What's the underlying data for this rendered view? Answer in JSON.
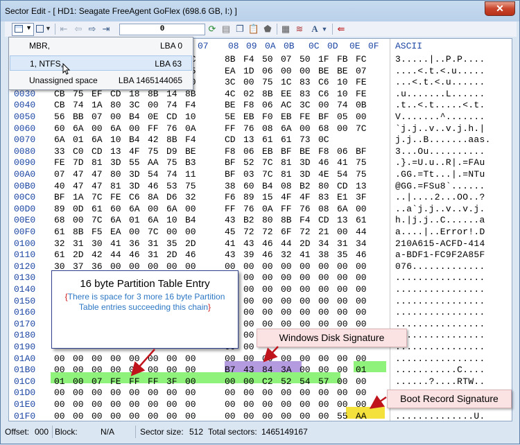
{
  "window": {
    "title": "Sector Edit - [ HD1: Seagate FreeAgent GoFlex (698.6 GB, I:) ]",
    "close_glyph": "✕"
  },
  "toolbar": {
    "lba_value": "0",
    "icons": [
      "partition-dropdown-icon",
      "view-dropdown-icon",
      "first-icon",
      "back-icon",
      "forward-icon",
      "last-icon",
      "refresh-icon",
      "save-icon",
      "copy-icon",
      "paste-icon",
      "fill-icon",
      "calculator-icon",
      "codepage-icon",
      "font-icon",
      "exit-icon"
    ]
  },
  "menu": {
    "items": [
      {
        "label": "MBR,",
        "lba": "LBA 0"
      },
      {
        "label": "1, NTFS,",
        "lba": "LBA 63"
      },
      {
        "label": "Unassigned space",
        "lba": "LBA 1465144065"
      }
    ]
  },
  "hex_header": {
    "cols": [
      "07",
      "08",
      "09",
      "0A",
      "0B",
      "0C",
      "0D",
      "0E",
      "0F"
    ],
    "ascii": "ASCII"
  },
  "rows": [
    {
      "off": "0000",
      "bytes": [
        "",
        "",
        "",
        "",
        "",
        "",
        "",
        "7C",
        "8B",
        "F4",
        "50",
        "07",
        "50",
        "1F",
        "FB",
        "FC"
      ],
      "ascii": "3.....|..P.P...."
    },
    {
      "off": "0010",
      "bytes": [
        "",
        "",
        "",
        "",
        "",
        "",
        "",
        "A5",
        "EA",
        "1D",
        "06",
        "00",
        "00",
        "BE",
        "BE",
        "07"
      ],
      "ascii": "....<.t.<.u....."
    },
    {
      "off": "0020",
      "bytes": [
        "",
        "",
        "",
        "",
        "",
        "",
        "",
        "80",
        "3C",
        "00",
        "75",
        "1C",
        "83",
        "C6",
        "10",
        "FE"
      ],
      "ascii": "...<.t.<.u......"
    },
    {
      "off": "0030",
      "bytes": [
        "CB",
        "75",
        "EF",
        "CD",
        "18",
        "8B",
        "14",
        "8B",
        "4C",
        "02",
        "8B",
        "EE",
        "83",
        "C6",
        "10",
        "FE"
      ],
      "ascii": ".u.......L......"
    },
    {
      "off": "0040",
      "bytes": [
        "CB",
        "74",
        "1A",
        "80",
        "3C",
        "00",
        "74",
        "F4",
        "BE",
        "F8",
        "06",
        "AC",
        "3C",
        "00",
        "74",
        "0B"
      ],
      "ascii": ".t..<.t.....<.t."
    },
    {
      "off": "0050",
      "bytes": [
        "56",
        "BB",
        "07",
        "00",
        "B4",
        "0E",
        "CD",
        "10",
        "5E",
        "EB",
        "F0",
        "EB",
        "FE",
        "BF",
        "05",
        "00"
      ],
      "ascii": "V.......^......."
    },
    {
      "off": "0060",
      "bytes": [
        "60",
        "6A",
        "00",
        "6A",
        "00",
        "FF",
        "76",
        "0A",
        "FF",
        "76",
        "08",
        "6A",
        "00",
        "68",
        "00",
        "7C"
      ],
      "ascii": "`j.j..v..v.j.h.|"
    },
    {
      "off": "0070",
      "bytes": [
        "6A",
        "01",
        "6A",
        "10",
        "B4",
        "42",
        "8B",
        "F4",
        "CD",
        "13",
        "61",
        "61",
        "73",
        "0C",
        "",
        ""
      ],
      "ascii": "j.j..B.......aas."
    },
    {
      "off": "0080",
      "bytes": [
        "33",
        "C0",
        "CD",
        "13",
        "4F",
        "75",
        "D9",
        "BE",
        "F8",
        "06",
        "EB",
        "BF",
        "BE",
        "F8",
        "06",
        "BF"
      ],
      "ascii": "3...Ou.........."
    },
    {
      "off": "0090",
      "bytes": [
        "FE",
        "7D",
        "81",
        "3D",
        "55",
        "AA",
        "75",
        "B3",
        "BF",
        "52",
        "7C",
        "81",
        "3D",
        "46",
        "41",
        "75"
      ],
      "ascii": ".}.=U.u..R|.=FAu"
    },
    {
      "off": "00A0",
      "bytes": [
        "07",
        "47",
        "47",
        "80",
        "3D",
        "54",
        "74",
        "11",
        "BF",
        "03",
        "7C",
        "81",
        "3D",
        "4E",
        "54",
        "75"
      ],
      "ascii": ".GG.=Tt...|.=NTu"
    },
    {
      "off": "00B0",
      "bytes": [
        "40",
        "47",
        "47",
        "81",
        "3D",
        "46",
        "53",
        "75",
        "38",
        "60",
        "B4",
        "08",
        "B2",
        "80",
        "CD",
        "13"
      ],
      "ascii": "@GG.=FSu8`......"
    },
    {
      "off": "00C0",
      "bytes": [
        "BF",
        "1A",
        "7C",
        "FE",
        "C6",
        "8A",
        "D6",
        "32",
        "F6",
        "89",
        "15",
        "4F",
        "4F",
        "83",
        "E1",
        "3F"
      ],
      "ascii": "..|....2...OO..?"
    },
    {
      "off": "00D0",
      "bytes": [
        "89",
        "0D",
        "61",
        "60",
        "6A",
        "00",
        "6A",
        "00",
        "FF",
        "76",
        "0A",
        "FF",
        "76",
        "08",
        "6A",
        "00"
      ],
      "ascii": "..a`j.j..v..v.j."
    },
    {
      "off": "00E0",
      "bytes": [
        "68",
        "00",
        "7C",
        "6A",
        "01",
        "6A",
        "10",
        "B4",
        "43",
        "B2",
        "80",
        "8B",
        "F4",
        "CD",
        "13",
        "61"
      ],
      "ascii": "h.|j.j..C......a"
    },
    {
      "off": "00F0",
      "bytes": [
        "61",
        "8B",
        "F5",
        "EA",
        "00",
        "7C",
        "00",
        "00",
        "45",
        "72",
        "72",
        "6F",
        "72",
        "21",
        "00",
        "44"
      ],
      "ascii": "a....|..Error!.D"
    },
    {
      "off": "0100",
      "bytes": [
        "32",
        "31",
        "30",
        "41",
        "36",
        "31",
        "35",
        "2D",
        "41",
        "43",
        "46",
        "44",
        "2D",
        "34",
        "31",
        "34"
      ],
      "ascii": "210A615-ACFD-414"
    },
    {
      "off": "0110",
      "bytes": [
        "61",
        "2D",
        "42",
        "44",
        "46",
        "31",
        "2D",
        "46",
        "43",
        "39",
        "46",
        "32",
        "41",
        "38",
        "35",
        "46"
      ],
      "ascii": "a-BDF1-FC9F2A85F"
    },
    {
      "off": "0120",
      "bytes": [
        "30",
        "37",
        "36",
        "00",
        "00",
        "00",
        "00",
        "00",
        "00",
        "00",
        "00",
        "00",
        "00",
        "00",
        "00",
        "00"
      ],
      "ascii": "076............."
    },
    {
      "off": "0130",
      "bytes": [
        "",
        "",
        "",
        "",
        "",
        "",
        "",
        "",
        "00",
        "00",
        "00",
        "00",
        "00",
        "00",
        "00",
        "00"
      ],
      "ascii": "................"
    },
    {
      "off": "0140",
      "bytes": [
        "",
        "",
        "",
        "",
        "",
        "",
        "",
        "",
        "00",
        "00",
        "00",
        "00",
        "00",
        "00",
        "00",
        "00"
      ],
      "ascii": "................"
    },
    {
      "off": "0150",
      "bytes": [
        "",
        "",
        "",
        "",
        "",
        "",
        "",
        "",
        "00",
        "00",
        "00",
        "00",
        "00",
        "00",
        "00",
        "00"
      ],
      "ascii": "................"
    },
    {
      "off": "0160",
      "bytes": [
        "",
        "",
        "",
        "",
        "",
        "",
        "",
        "",
        "00",
        "00",
        "00",
        "00",
        "00",
        "00",
        "00",
        "00"
      ],
      "ascii": "................"
    },
    {
      "off": "0170",
      "bytes": [
        "",
        "",
        "",
        "",
        "",
        "",
        "",
        "",
        "00",
        "00",
        "00",
        "00",
        "00",
        "00",
        "00",
        "00"
      ],
      "ascii": "................"
    },
    {
      "off": "0180",
      "bytes": [
        "",
        "",
        "",
        "",
        "",
        "",
        "",
        "",
        "00",
        "00",
        "",
        "",
        "",
        "",
        "",
        ""
      ],
      "ascii": "................"
    },
    {
      "off": "0190",
      "bytes": [
        "",
        "",
        "",
        "",
        "",
        "",
        "",
        "",
        "00",
        "00",
        "",
        "",
        "",
        "",
        "",
        ""
      ],
      "ascii": "................"
    },
    {
      "off": "01A0",
      "bytes": [
        "00",
        "00",
        "00",
        "00",
        "00",
        "00",
        "00",
        "00",
        "00",
        "00",
        "00",
        "00",
        "00",
        "00",
        "00",
        "00"
      ],
      "ascii": "................"
    },
    {
      "off": "01B0",
      "bytes": [
        "00",
        "00",
        "00",
        "00",
        "00",
        "00",
        "00",
        "00",
        "B7",
        "43",
        "84",
        "3A",
        "00",
        "00",
        "00",
        "01"
      ],
      "ascii": "...........C...."
    },
    {
      "off": "01C0",
      "bytes": [
        "01",
        "00",
        "07",
        "FE",
        "FF",
        "FF",
        "3F",
        "00",
        "00",
        "00",
        "C2",
        "52",
        "54",
        "57",
        "00",
        "00"
      ],
      "ascii": "......?....RTW.."
    },
    {
      "off": "01D0",
      "bytes": [
        "00",
        "00",
        "00",
        "00",
        "00",
        "00",
        "00",
        "00",
        "00",
        "00",
        "00",
        "00",
        "00",
        "00",
        "00",
        "00"
      ],
      "ascii": "................"
    },
    {
      "off": "01E0",
      "bytes": [
        "00",
        "00",
        "00",
        "00",
        "00",
        "00",
        "00",
        "00",
        "00",
        "00",
        "00",
        "00",
        "00",
        "00",
        "00",
        "00"
      ],
      "ascii": "................"
    },
    {
      "off": "01F0",
      "bytes": [
        "00",
        "00",
        "00",
        "00",
        "00",
        "00",
        "00",
        "00",
        "00",
        "00",
        "00",
        "00",
        "00",
        "00",
        "55",
        "AA"
      ],
      "ascii": "..............U."
    }
  ],
  "callouts": {
    "partition": {
      "title": "16 byte Partition Table Entry",
      "open_brace": "{",
      "body": "There is space for 3 more 16 byte Partition Table entries succeeding this chain",
      "close_brace": "}"
    },
    "disk_signature": "Windows Disk Signature",
    "boot_signature": "Boot Record Signature"
  },
  "status": {
    "offset_label": "Offset:",
    "offset_value": "000",
    "block_label": "Block:",
    "block_value": "N/A",
    "sector_size_label": "Sector size:",
    "sector_size_value": "512",
    "total_label": "Total sectors:",
    "total_value": "1465149167"
  },
  "colors": {
    "partition_highlight": "#8ff27a",
    "disk_signature_highlight": "#b49be0",
    "boot_signature_highlight": "#f4e13b",
    "offset_text": "#1c46a4",
    "arrow": "#c0141c"
  }
}
